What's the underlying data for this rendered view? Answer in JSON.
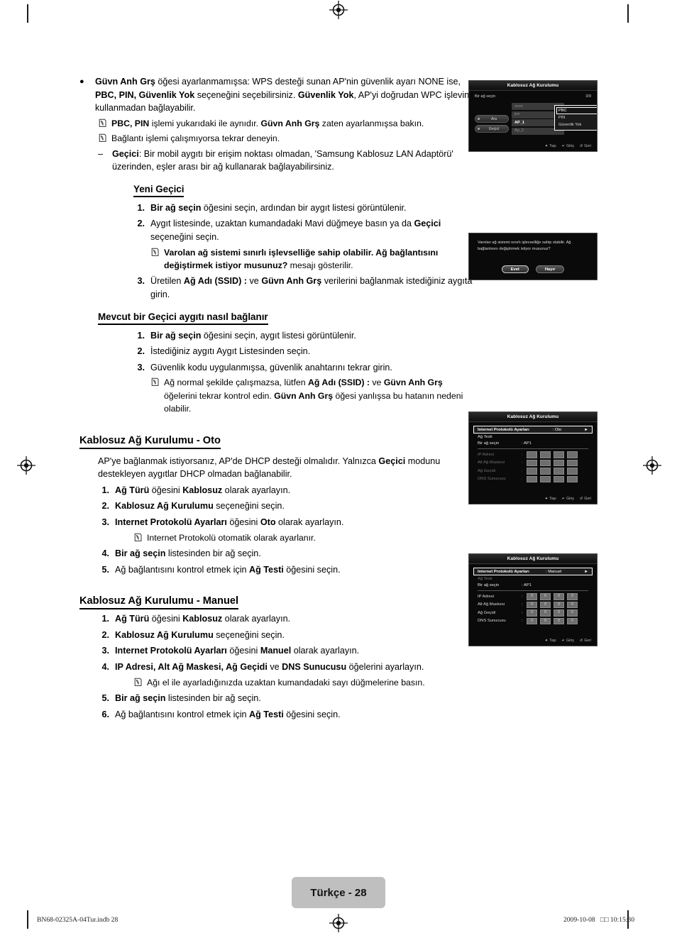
{
  "page": {
    "badge": "Türkçe - 28",
    "footer_left": "BN68-02325A-04Tur.indb   28",
    "footer_right": "2009-10-08   □□ 10:15:30"
  },
  "content": {
    "bullet1": {
      "marker": "●",
      "segments": [
        {
          "t": "Güvn Anh Grş",
          "b": true
        },
        {
          "t": "  öğesi ayarlanmamışsa: WPS desteği sunan AP'nin güvenlik ayarı NONE ise, ",
          "b": false
        },
        {
          "t": "PBC, PIN, Güvenlik Yok",
          "b": true
        },
        {
          "t": " seçeneğini seçebilirsiniz. ",
          "b": false
        },
        {
          "t": "Güvenlik Yok",
          "b": true
        },
        {
          "t": ", AP'yi doğrudan WPC işlevini kullanmadan bağlayabilir.",
          "b": false
        }
      ]
    },
    "note1": [
      {
        "t": "PBC, PIN",
        "b": true
      },
      {
        "t": " işlemi yukarıdaki ile aynıdır. ",
        "b": false
      },
      {
        "t": "Güvn Anh Grş",
        "b": true
      },
      {
        "t": " zaten ayarlanmışsa bakın.",
        "b": false
      }
    ],
    "note2": [
      {
        "t": "Bağlantı işlemi çalışmıyorsa tekrar deneyin.",
        "b": false
      }
    ],
    "dash1": {
      "marker": "–",
      "segments": [
        {
          "t": "Geçici",
          "b": true
        },
        {
          "t": ": Bir mobil aygıtı bir erişim noktası olmadan, 'Samsung Kablosuz LAN Adaptörü' üzerinden, eşler arası bir ağ kullanarak bağlayabilirsiniz.",
          "b": false
        }
      ]
    },
    "heading_yeni_gecici": "Yeni Geçici",
    "yeni_gecici_steps": [
      {
        "n": "1.",
        "segments": [
          {
            "t": "Bir ağ seçin",
            "b": true
          },
          {
            "t": " öğesini seçin, ardından  bir aygıt listesi görüntülenir.",
            "b": false
          }
        ]
      },
      {
        "n": "2.",
        "segments": [
          {
            "t": "Aygıt listesinde, uzaktan kumandadaki Mavi düğmeye basın ya da ",
            "b": false
          },
          {
            "t": "Geçici",
            "b": true
          },
          {
            "t": " seçeneğini seçin.",
            "b": false
          }
        ]
      },
      {
        "n": "3.",
        "segments": [
          {
            "t": "Üretilen ",
            "b": false
          },
          {
            "t": "Ağ Adı (SSID) :",
            "b": true
          },
          {
            "t": " ve ",
            "b": false
          },
          {
            "t": "Güvn Anh Grş",
            "b": true
          },
          {
            "t": " verilerini bağlanmak istediğiniz aygıta girin.",
            "b": false
          }
        ]
      }
    ],
    "note3": [
      {
        "t": "Varolan ağ sistemi sınırlı işlevselliğe sahip olabilir. Ağ bağlantısını değiştirmek istiyor musunuz?",
        "b": true
      },
      {
        "t": " mesajı gösterilir.",
        "b": false
      }
    ],
    "heading_mevcut": "Mevcut bir Geçici aygıtı nasıl bağlanır",
    "mevcut_steps": [
      {
        "n": "1.",
        "segments": [
          {
            "t": "Bir ağ seçin",
            "b": true
          },
          {
            "t": " öğesini seçin, aygıt listesi görüntülenir.",
            "b": false
          }
        ]
      },
      {
        "n": "2.",
        "segments": [
          {
            "t": "İstediğiniz aygıtı Aygıt Listesinden seçin.",
            "b": false
          }
        ]
      },
      {
        "n": "3.",
        "segments": [
          {
            "t": "Güvenlik kodu uygulanmışsa, güvenlik anahtarını tekrar girin.",
            "b": false
          }
        ]
      }
    ],
    "note4": [
      {
        "t": "Ağ normal şekilde çalışmazsa, lütfen ",
        "b": false
      },
      {
        "t": "Ağ Adı (SSID) :",
        "b": true
      },
      {
        "t": " ve ",
        "b": false
      },
      {
        "t": "Güvn Anh Grş",
        "b": true
      },
      {
        "t": " öğelerini tekrar kontrol edin. ",
        "b": false
      },
      {
        "t": "Güvn Anh Grş",
        "b": true
      },
      {
        "t": " öğesi yanlışsa bu hatanın nedeni olabilir.",
        "b": false
      }
    ],
    "heading_oto": "Kablosuz Ağ Kurulumu - Oto",
    "oto_intro": [
      {
        "t": "AP'ye bağlanmak istiyorsanız, AP'de DHCP desteği olmalıdır. Yalnızca ",
        "b": false
      },
      {
        "t": "Geçici",
        "b": true
      },
      {
        "t": " modunu destekleyen aygıtlar DHCP olmadan bağlanabilir.",
        "b": false
      }
    ],
    "oto_steps": [
      {
        "n": "1.",
        "segments": [
          {
            "t": "Ağ Türü",
            "b": true
          },
          {
            "t": " öğesini ",
            "b": false
          },
          {
            "t": "Kablosuz",
            "b": true
          },
          {
            "t": "  olarak ayarlayın.",
            "b": false
          }
        ]
      },
      {
        "n": "2.",
        "segments": [
          {
            "t": "Kablosuz Ağ Kurulumu",
            "b": true
          },
          {
            "t": " seçeneğini seçin.",
            "b": false
          }
        ]
      },
      {
        "n": "3.",
        "segments": [
          {
            "t": "Internet Protokolü Ayarları",
            "b": true
          },
          {
            "t": " öğesini ",
            "b": false
          },
          {
            "t": "Oto",
            "b": true
          },
          {
            "t": " olarak ayarlayın.",
            "b": false
          }
        ]
      }
    ],
    "note5": [
      {
        "t": "Internet Protokolü otomatik olarak ayarlanır.",
        "b": false
      }
    ],
    "oto_steps2": [
      {
        "n": "4.",
        "segments": [
          {
            "t": "Bir ağ seçin",
            "b": true
          },
          {
            "t": " listesinden bir ağ seçin.",
            "b": false
          }
        ]
      },
      {
        "n": "5.",
        "segments": [
          {
            "t": "Ağ bağlantısını kontrol etmek için ",
            "b": false
          },
          {
            "t": "Ağ Testi",
            "b": true
          },
          {
            "t": " öğesini seçin.",
            "b": false
          }
        ]
      }
    ],
    "heading_manuel": "Kablosuz Ağ Kurulumu - Manuel",
    "manuel_steps": [
      {
        "n": "1.",
        "segments": [
          {
            "t": "Ağ Türü",
            "b": true
          },
          {
            "t": " öğesini ",
            "b": false
          },
          {
            "t": "Kablosuz",
            "b": true
          },
          {
            "t": "  olarak ayarlayın.",
            "b": false
          }
        ]
      },
      {
        "n": "2.",
        "segments": [
          {
            "t": "Kablosuz Ağ Kurulumu",
            "b": true
          },
          {
            "t": " seçeneğini seçin.",
            "b": false
          }
        ]
      },
      {
        "n": "3.",
        "segments": [
          {
            "t": "Internet Protokolü Ayarları",
            "b": true
          },
          {
            "t": " öğesini ",
            "b": false
          },
          {
            "t": "Manuel",
            "b": true
          },
          {
            "t": " olarak ayarlayın.",
            "b": false
          }
        ]
      },
      {
        "n": "4.",
        "segments": [
          {
            "t": "IP Adresi, Alt Ağ Maskesi, Ağ Geçidi",
            "b": true
          },
          {
            "t": " ve ",
            "b": false
          },
          {
            "t": "DNS Sunucusu",
            "b": true
          },
          {
            "t": " öğelerini ayarlayın.",
            "b": false
          }
        ]
      }
    ],
    "note6": [
      {
        "t": "Ağı el ile ayarladığınızda uzaktan kumandadaki sayı düğmelerine basın.",
        "b": false
      }
    ],
    "manuel_steps2": [
      {
        "n": "5.",
        "segments": [
          {
            "t": "Bir ağ seçin",
            "b": true
          },
          {
            "t": " listesinden bir ağ seçin.",
            "b": false
          }
        ]
      },
      {
        "n": "6.",
        "segments": [
          {
            "t": "Ağ bağlantısını kontrol etmek için ",
            "b": false
          },
          {
            "t": "Ağ Testi",
            "b": true
          },
          {
            "t": " öğesini seçin.",
            "b": false
          }
        ]
      }
    ]
  },
  "tv_screen_1": {
    "title": "Kablosuz Ağ Kurulumu",
    "row_label": "Bir ağ seçin",
    "row_value": "3/9",
    "networks": [
      {
        "name": "sson",
        "selected": false
      },
      {
        "name": "jee",
        "selected": false
      },
      {
        "name": "AP_1",
        "selected": true
      },
      {
        "name": "Ap_2",
        "selected": false
      }
    ],
    "side_buttons": [
      "Ara",
      "Geçici"
    ],
    "dropdown": [
      {
        "label": "PBC",
        "selected": true
      },
      {
        "label": "PIN",
        "selected": false
      },
      {
        "label": "Güvenlik Yok",
        "selected": false
      }
    ],
    "footer": [
      {
        "icon": "move-icon",
        "label": "Taşı"
      },
      {
        "icon": "enter-icon",
        "label": "Giriş"
      },
      {
        "icon": "return-icon",
        "label": "Geri"
      }
    ]
  },
  "tv_screen_2": {
    "message": "Varolan ağ sistemi sınırlı işlevselliğe sahip olabilir. Ağ bağlantısını değiştirmek istiyor musunuz?",
    "buttons": [
      {
        "label": "Evet",
        "primary": true
      },
      {
        "label": "Hayır",
        "primary": false
      }
    ]
  },
  "tv_screen_3": {
    "title": "Kablosuz Ağ Kurulumu",
    "highlight": {
      "label": "Internet Protokolü Ayarları",
      "value": ": Oto",
      "arrow": "►"
    },
    "lines": [
      {
        "label": "Ağ Testi",
        "value": "",
        "dim": false
      },
      {
        "label": "Bir ağ seçin",
        "value": ": AP1",
        "dim": false
      }
    ],
    "grid": [
      {
        "label": "IP Adresi",
        "colon": ":",
        "boxes": [
          "",
          "",
          "",
          ""
        ]
      },
      {
        "label": "Alt Ağ Maskesi",
        "colon": ":",
        "boxes": [
          "",
          "",
          "",
          ""
        ]
      },
      {
        "label": "Ağ Geçidi",
        "colon": ":",
        "boxes": [
          "",
          "",
          "",
          ""
        ]
      },
      {
        "label": "DNS Sunucusu",
        "colon": ":",
        "boxes": [
          "",
          "",
          "",
          ""
        ]
      }
    ],
    "grid_dim": true,
    "footer": [
      {
        "icon": "move-icon",
        "label": "Taşı"
      },
      {
        "icon": "enter-icon",
        "label": "Giriş"
      },
      {
        "icon": "return-icon",
        "label": "Geri"
      }
    ]
  },
  "tv_screen_4": {
    "title": "Kablosuz Ağ Kurulumu",
    "highlight": {
      "label": "Internet Protokolü Ayarları",
      "value": ": Manuel",
      "arrow": "►"
    },
    "lines": [
      {
        "label": "Ağ Testi",
        "value": "",
        "dim": true
      },
      {
        "label": "Bir ağ seçin",
        "value": ": AP1",
        "dim": false
      }
    ],
    "grid": [
      {
        "label": "IP Adresi",
        "colon": ":",
        "boxes": [
          "0",
          "0",
          "0",
          "0"
        ]
      },
      {
        "label": "Alt Ağ Maskesi",
        "colon": ":",
        "boxes": [
          "0",
          "0",
          "0",
          "0"
        ]
      },
      {
        "label": "Ağ Geçidi",
        "colon": ":",
        "boxes": [
          "0",
          "0",
          "0",
          "0"
        ]
      },
      {
        "label": "DNS Sunucusu",
        "colon": ":",
        "boxes": [
          "0",
          "0",
          "0",
          "0"
        ]
      }
    ],
    "grid_dim": false,
    "footer": [
      {
        "icon": "move-icon",
        "label": "Taşı"
      },
      {
        "icon": "enter-icon",
        "label": "Giriş"
      },
      {
        "icon": "return-icon",
        "label": "Geri"
      }
    ]
  }
}
